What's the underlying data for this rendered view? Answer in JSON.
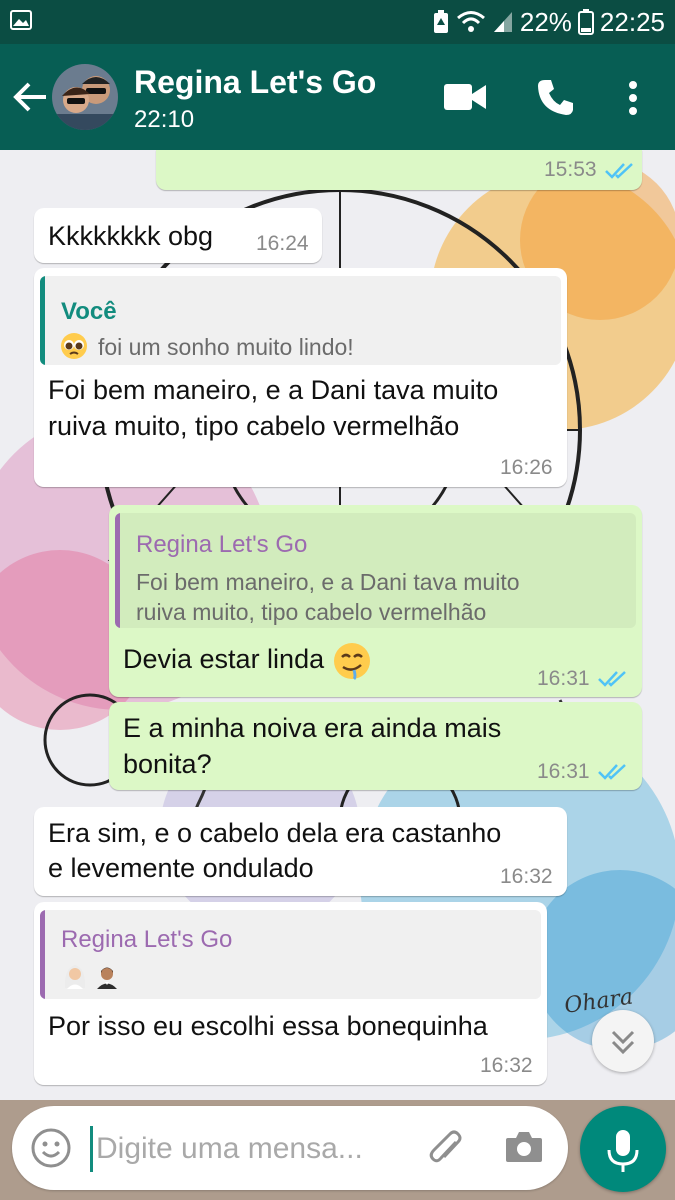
{
  "status_bar": {
    "battery_percent": "22%",
    "clock": "22:25"
  },
  "header": {
    "contact_name": "Regina Let's Go",
    "last_seen": "22:10"
  },
  "messages": [
    {
      "direction": "outgoing",
      "time": "15:53",
      "read": true
    },
    {
      "direction": "incoming",
      "text": "Kkkkkkkk obg",
      "time": "16:24"
    },
    {
      "direction": "incoming",
      "quote": {
        "author": "Você",
        "emoji": "pleading-face",
        "text": "foi um sonho muito lindo!"
      },
      "lines": [
        "Foi bem maneiro, e a Dani tava muito",
        "ruiva muito, tipo cabelo vermelhão"
      ],
      "time": "16:26"
    },
    {
      "direction": "outgoing",
      "quote": {
        "author": "Regina Let's Go",
        "lines": [
          "Foi bem maneiro, e a Dani tava muito",
          "ruiva muito, tipo cabelo vermelhão"
        ]
      },
      "text": "Devia estar linda",
      "emoji": "drooling-face",
      "time": "16:31",
      "read": true
    },
    {
      "direction": "outgoing",
      "lines": [
        "E a minha noiva era ainda mais",
        "bonita?"
      ],
      "time": "16:31",
      "read": true
    },
    {
      "direction": "incoming",
      "lines": [
        "Era sim, e o cabelo dela era castanho",
        "e levemente ondulado"
      ],
      "time": "16:32"
    },
    {
      "direction": "incoming",
      "quote": {
        "author": "Regina Let's Go",
        "emojis": [
          "bride-with-veil",
          "man-in-tuxedo"
        ]
      },
      "text": "Por isso eu escolhi essa bonequinha",
      "time": "16:32"
    }
  ],
  "compose": {
    "placeholder": "Digite uma mensa..."
  },
  "colors": {
    "header": "#075e54",
    "status_bar": "#0b4d43",
    "outgoing_bubble": "#dcf8c6",
    "incoming_bubble": "#ffffff",
    "read_ticks": "#4fc3f7",
    "quote_you": "#128c7e",
    "quote_contact": "#9c6ab0",
    "fab": "#00897b"
  },
  "icons": [
    "gallery-icon",
    "battery-saver-icon",
    "wifi-icon",
    "signal-icon",
    "battery-icon",
    "back-arrow-icon",
    "video-call-icon",
    "phone-icon",
    "more-vert-icon",
    "double-check-icon",
    "scroll-down-icon",
    "emoji-icon",
    "attach-icon",
    "camera-icon",
    "mic-icon"
  ],
  "background_signature": "Ohara"
}
